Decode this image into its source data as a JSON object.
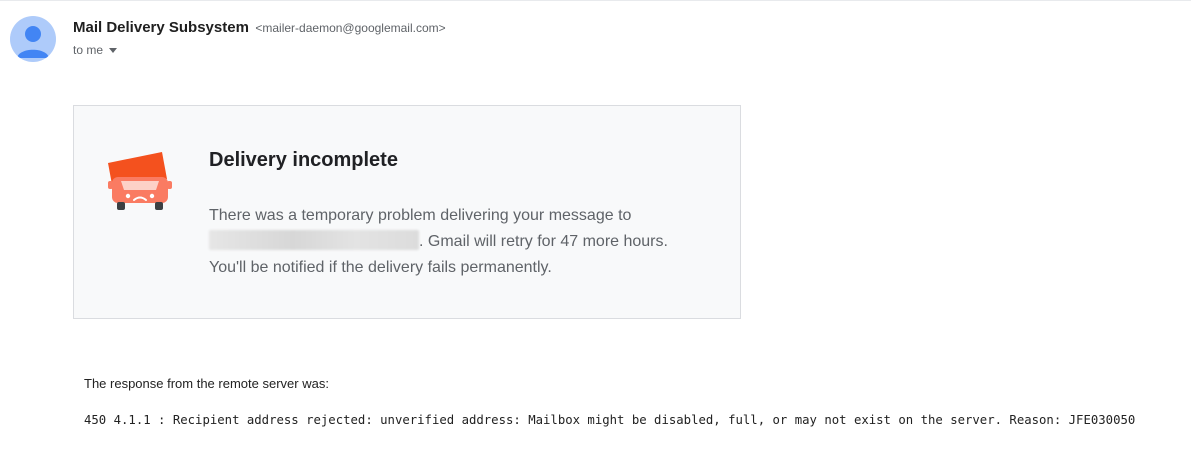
{
  "header": {
    "sender_name": "Mail Delivery Subsystem",
    "sender_email": "<mailer-daemon@googlemail.com>",
    "to_label": "to me"
  },
  "card": {
    "title": "Delivery incomplete",
    "body_line1": "There was a temporary problem delivering your message to",
    "body_line2_suffix": ". Gmail will retry for 47 more hours.",
    "body_line3": "You'll be notified if the delivery fails permanently.",
    "icon": "delivery-truck-sad-icon"
  },
  "response": {
    "label": "The response from the remote server was:",
    "code": "450 4.1.1 : Recipient address rejected: unverified address: Mailbox might be disabled, full, or may not exist on the server. Reason: JFE030050"
  },
  "colors": {
    "truck": "#f4511e",
    "avatar_bg": "#aecbfa",
    "avatar_fg": "#4285f4",
    "card_bg": "#f8f9fa"
  }
}
